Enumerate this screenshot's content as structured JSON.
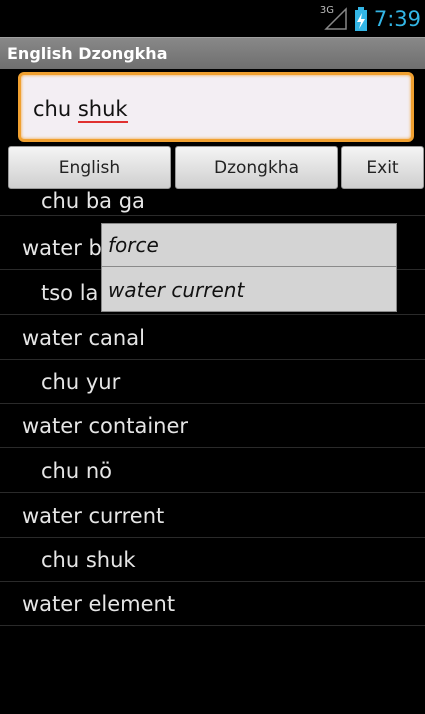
{
  "status_bar": {
    "network_label": "3G",
    "time": "7:39",
    "signal_icon": "signal-icon",
    "battery_icon": "battery-charging-icon"
  },
  "app": {
    "title": "English Dzongkha"
  },
  "search": {
    "value_plain": "chu ",
    "value_marked": "shuk"
  },
  "buttons": {
    "english": "English",
    "dzongkha": "Dzongkha",
    "exit": "Exit"
  },
  "list_items": [
    {
      "kind": "dz",
      "text": "chu ba ga"
    },
    {
      "kind": "en",
      "text": "water b"
    },
    {
      "kind": "dz",
      "text": "tso la"
    },
    {
      "kind": "en",
      "text": "water canal"
    },
    {
      "kind": "dz",
      "text": "chu yur"
    },
    {
      "kind": "en",
      "text": "water container"
    },
    {
      "kind": "dz",
      "text": "chu nö"
    },
    {
      "kind": "en",
      "text": "water current"
    },
    {
      "kind": "dz",
      "text": "chu shuk"
    },
    {
      "kind": "en",
      "text": "water element"
    }
  ],
  "popup": {
    "items": [
      "force",
      "water current"
    ]
  },
  "colors": {
    "accent": "#33b5e5",
    "focus_border": "#f0a030",
    "spell_underline": "#e03030"
  }
}
